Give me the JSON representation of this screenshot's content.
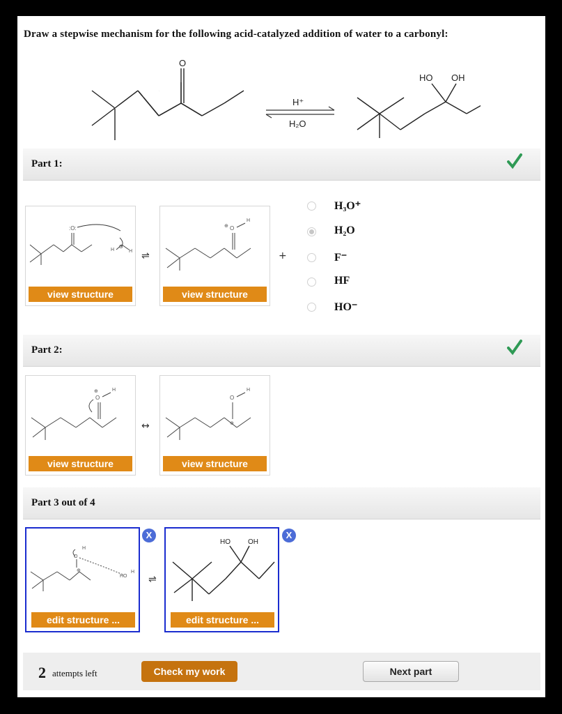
{
  "prompt": "Draw a stepwise mechanism for the following acid-catalyzed addition of water to a carbonyl:",
  "reaction": {
    "reactant_o": "O",
    "product_ho": "HO",
    "product_oh": "OH",
    "reagent_top": "H⁺",
    "reagent_bottom": "H₂O"
  },
  "part1": {
    "title": "Part 1:",
    "view_button_1": "view structure",
    "view_button_2": "view structure",
    "equilibrium": "⇌",
    "plus": "+",
    "options": [
      {
        "label": "H₃O⁺",
        "selected": false
      },
      {
        "label": "H₂O",
        "selected": true
      },
      {
        "label": "F⁻",
        "selected": false
      },
      {
        "label": "HF",
        "selected": false
      },
      {
        "label": "HO⁻",
        "selected": false
      }
    ]
  },
  "part2": {
    "title": "Part 2:",
    "view_button_1": "view structure",
    "view_button_2": "view structure",
    "resonance": "↔"
  },
  "part3": {
    "title": "Part 3 out of 4",
    "edit_button_1": "edit structure ...",
    "edit_button_2": "edit structure ...",
    "remove_label": "X",
    "equilibrium": "⇌",
    "card2_ho": "HO",
    "card2_oh": "OH"
  },
  "footer": {
    "attempts_count": "2",
    "attempts_text": "attempts left",
    "check_button": "Check my work",
    "next_button": "Next part"
  },
  "colors": {
    "accent_orange": "#e08a17",
    "check_green": "#2f9a55",
    "selected_border": "#1a2ccf"
  }
}
